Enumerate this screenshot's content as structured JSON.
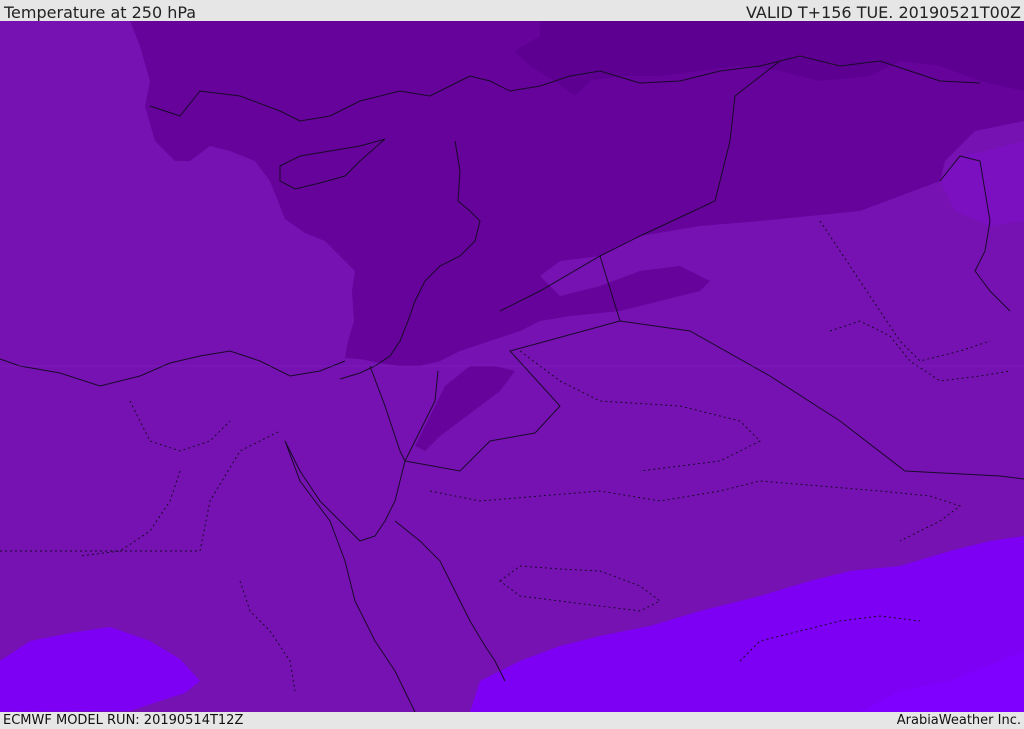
{
  "header": {
    "title": "Temperature at 250 hPa",
    "valid": "VALID T+156 TUE. 20190521T00Z"
  },
  "footer": {
    "model_run": "ECMWF MODEL RUN: 20190514T12Z",
    "credit": "ArabiaWeather Inc."
  },
  "map": {
    "colors": {
      "base": "#7612b2",
      "cold": "#65039a",
      "warm": "#8000ff",
      "border": "#1a0a2a"
    }
  }
}
